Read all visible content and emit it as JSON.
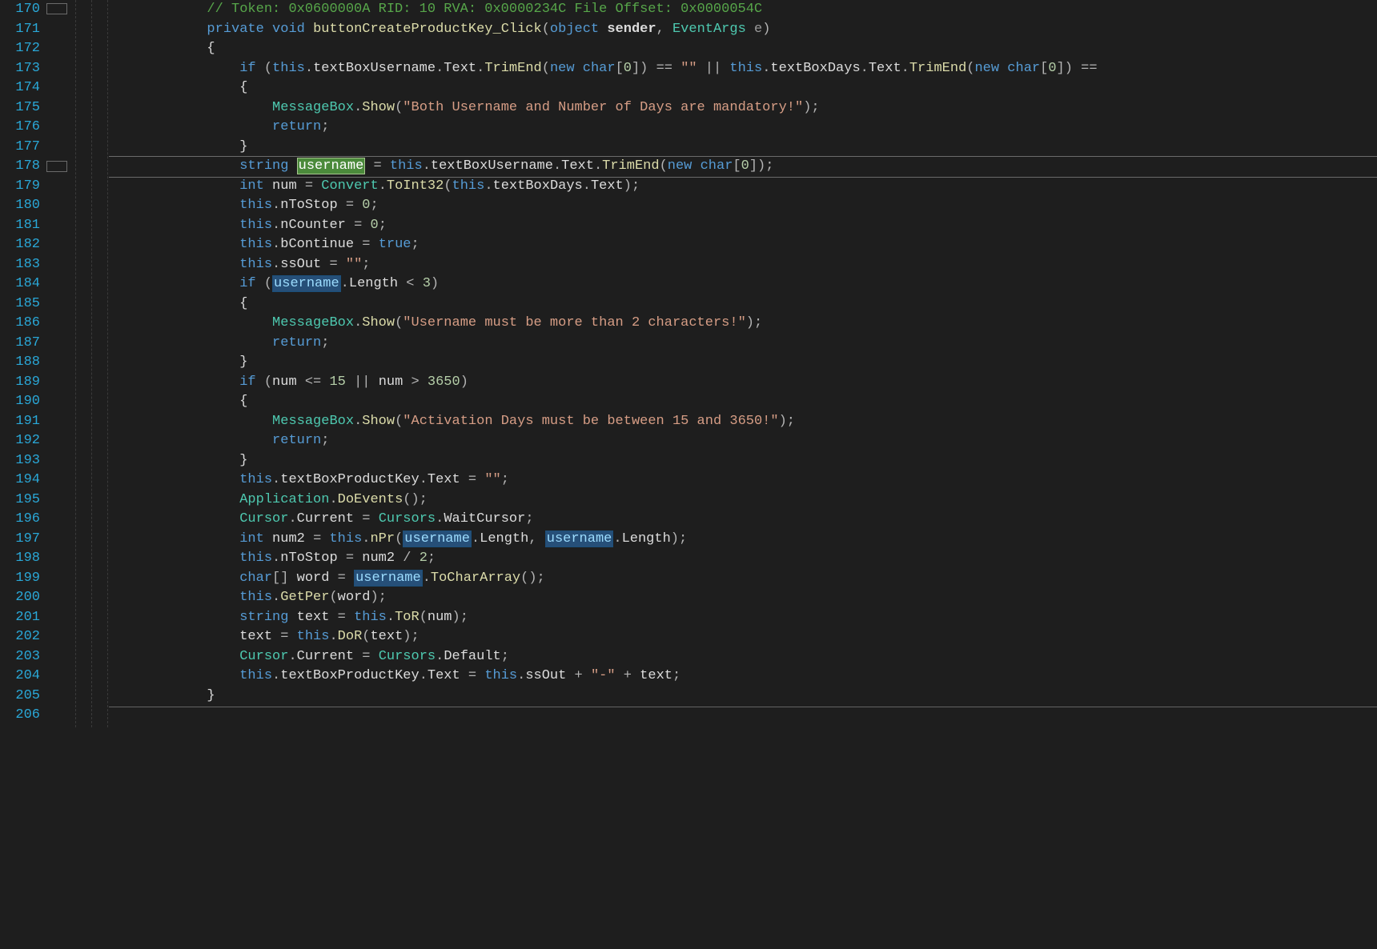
{
  "gutter": {
    "start": 170,
    "end": 206
  },
  "highlight_line": 178,
  "selection_word": "username",
  "code": {
    "l170": {
      "comment": "// Token: 0x0600000A RID: 10 RVA: 0x0000234C File Offset: 0x0000054C"
    },
    "l171": {
      "kw_private": "private",
      "kw_void": "void",
      "method": "buttonCreateProductKey_Click",
      "p_open": "(",
      "type_object": "object",
      "name_sender": "sender",
      "comma": ", ",
      "type_evt": "EventArgs",
      "name_e": "e",
      "p_close": ")"
    },
    "l172": {
      "brace": "{"
    },
    "l173": {
      "kw_if": "if",
      "p0": " (",
      "kw_this": "this",
      "d0": ".",
      "field1": "textBoxUsername",
      "d1": ".",
      "prop1": "Text",
      "d2": ".",
      "meth1": "TrimEnd",
      "p1": "(",
      "kw_new": "new",
      "sp": " ",
      "type_char": "char",
      "brk": "[",
      "zero": "0",
      "brk2": "]) ",
      "eqeq": "== ",
      "empty": "\"\"",
      "or": " || ",
      "kw_this2": "this",
      "d3": ".",
      "field2": "textBoxDays",
      "d4": ".",
      "prop2": "Text",
      "d5": ".",
      "meth2": "TrimEnd",
      "p2": "(",
      "kw_new2": "new",
      "sp2": " ",
      "type_char2": "char",
      "brk3": "[",
      "zero2": "0",
      "brk4": "]) ",
      "tail": "=="
    },
    "l174": {
      "brace": "{"
    },
    "l175": {
      "msgbox": "MessageBox",
      "dot": ".",
      "show": "Show",
      "popen": "(",
      "msg": "\"Both Username and Number of Days are mandatory!\"",
      "pclose": ");"
    },
    "l176": {
      "kw_return": "return",
      "semi": ";"
    },
    "l177": {
      "brace": "}"
    },
    "l178": {
      "kw_string": "string",
      "sp": " ",
      "var_username": "username",
      "sp2": " ",
      "eq": "= ",
      "kw_this": "this",
      "d0": ".",
      "field": "textBoxUsername",
      "d1": ".",
      "prop": "Text",
      "d2": ".",
      "meth": "TrimEnd",
      "p1": "(",
      "kw_new": "new",
      "sp3": " ",
      "type_char": "char",
      "brk": "[",
      "zero": "0",
      "brk2": "]);"
    },
    "l179": {
      "kw_int": "int",
      "var": " num ",
      "eq": "= ",
      "conv": "Convert",
      "dot": ".",
      "toint": "ToInt32",
      "popen": "(",
      "kw_this": "this",
      "d0": ".",
      "field": "textBoxDays",
      "d1": ".",
      "prop": "Text",
      "pclose": ");"
    },
    "l180": {
      "kw_this": "this",
      "dot": ".",
      "field": "nToStop",
      "eq": " = ",
      "zero": "0",
      "semi": ";"
    },
    "l181": {
      "kw_this": "this",
      "dot": ".",
      "field": "nCounter",
      "eq": " = ",
      "zero": "0",
      "semi": ";"
    },
    "l182": {
      "kw_this": "this",
      "dot": ".",
      "field": "bContinue",
      "eq": " = ",
      "true": "true",
      "semi": ";"
    },
    "l183": {
      "kw_this": "this",
      "dot": ".",
      "field": "ssOut",
      "eq": " = ",
      "empty": "\"\"",
      "semi": ";"
    },
    "l184": {
      "kw_if": "if",
      "popen": " (",
      "var_username": "username",
      "dot": ".",
      "length": "Length",
      "lt": " < ",
      "three": "3",
      "pclose": ")"
    },
    "l185": {
      "brace": "{"
    },
    "l186": {
      "msgbox": "MessageBox",
      "dot": ".",
      "show": "Show",
      "popen": "(",
      "msg": "\"Username must be more than 2 characters!\"",
      "pclose": ");"
    },
    "l187": {
      "kw_return": "return",
      "semi": ";"
    },
    "l188": {
      "brace": "}"
    },
    "l189": {
      "kw_if": "if",
      "popen": " (",
      "num": "num ",
      "le": "<= ",
      "n15": "15",
      "or": " || ",
      "num2": "num ",
      "gt": "> ",
      "n3650": "3650",
      "pclose": ")"
    },
    "l190": {
      "brace": "{"
    },
    "l191": {
      "msgbox": "MessageBox",
      "dot": ".",
      "show": "Show",
      "popen": "(",
      "msg": "\"Activation Days must be between 15 and 3650!\"",
      "pclose": ");"
    },
    "l192": {
      "kw_return": "return",
      "semi": ";"
    },
    "l193": {
      "brace": "}"
    },
    "l194": {
      "kw_this": "this",
      "dot": ".",
      "field": "textBoxProductKey",
      "dot2": ".",
      "prop": "Text",
      "eq": " = ",
      "empty": "\"\"",
      "semi": ";"
    },
    "l195": {
      "app": "Application",
      "dot": ".",
      "doev": "DoEvents",
      "popen": "(",
      "pclose": ");"
    },
    "l196": {
      "cursor": "Cursor",
      "dot": ".",
      "current": "Current",
      "eq": " = ",
      "cursors": "Cursors",
      "dot2": ".",
      "wait": "WaitCursor",
      "semi": ";"
    },
    "l197": {
      "kw_int": "int",
      "var": " num2 ",
      "eq": "= ",
      "kw_this": "this",
      "dot": ".",
      "npr": "nPr",
      "popen": "(",
      "u1": "username",
      "dot2": ".",
      "len1": "Length",
      "comma": ", ",
      "u2": "username",
      "dot3": ".",
      "len2": "Length",
      "pclose": ");"
    },
    "l198": {
      "kw_this": "this",
      "dot": ".",
      "field": "nToStop",
      "eq": " = ",
      "num2": "num2 ",
      "div": "/ ",
      "two": "2",
      "semi": ";"
    },
    "l199": {
      "kw_char": "char",
      "brk": "[]",
      "sp": " ",
      "word": "word",
      "eq": " = ",
      "u": "username",
      "dot": ".",
      "tca": "ToCharArray",
      "popen": "(",
      "pclose": ");"
    },
    "l200": {
      "kw_this": "this",
      "dot": ".",
      "getper": "GetPer",
      "popen": "(",
      "word": "word",
      "pclose": ");"
    },
    "l201": {
      "kw_string": "string",
      "var": " text ",
      "eq": "= ",
      "kw_this": "this",
      "dot": ".",
      "tor": "ToR",
      "popen": "(",
      "num": "num",
      "pclose": ");"
    },
    "l202": {
      "text": "text ",
      "eq": "= ",
      "kw_this": "this",
      "dot": ".",
      "dor": "DoR",
      "popen": "(",
      "txt": "text",
      "pclose": ");"
    },
    "l203": {
      "cursor": "Cursor",
      "dot": ".",
      "current": "Current",
      "eq": " = ",
      "cursors": "Cursors",
      "dot2": ".",
      "def": "Default",
      "semi": ";"
    },
    "l204": {
      "kw_this": "this",
      "dot": ".",
      "field": "textBoxProductKey",
      "dot2": ".",
      "prop": "Text",
      "eq": " = ",
      "kw_this2": "this",
      "dot3": ".",
      "ssout": "ssOut",
      "plus": " + ",
      "dash": "\"-\"",
      "plus2": " + ",
      "txt": "text",
      "semi": ";"
    },
    "l205": {
      "brace": "}"
    }
  },
  "indent": {
    "body": "            ",
    "inner1": "                ",
    "inner2": "                    ",
    "inner3": "                        "
  }
}
